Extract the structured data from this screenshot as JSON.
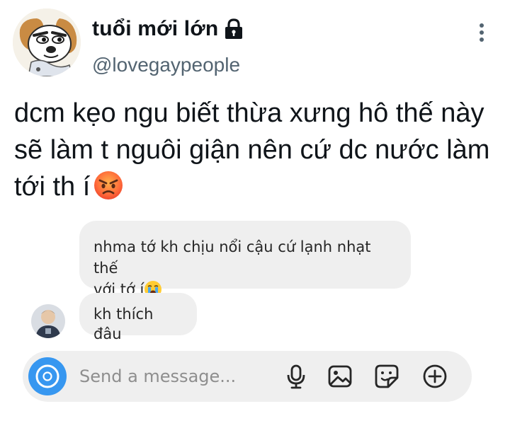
{
  "post": {
    "display_name": "tuổi mới lớn",
    "handle": "@lovegaypeople",
    "text": "dcm kẹo ngu biết thừa xưng hô thế này sẽ làm t nguôi giận nên cứ dc nước làm tới th í",
    "text_emoji": "angry-face-emoji"
  },
  "chat": {
    "messages": [
      {
        "text_line1": "nhma tớ kh chịu nổi cậu cứ lạnh nhạt thế",
        "text_line2": "với tớ í",
        "emoji": "loudly-crying-face-emoji"
      },
      {
        "text": "kh thích đâu"
      }
    ],
    "composer": {
      "placeholder": "Send a message...",
      "icons": [
        "camera-icon",
        "microphone-icon",
        "image-icon",
        "sticker-icon",
        "plus-circle-icon"
      ]
    }
  },
  "colors": {
    "text_primary": "#0f1419",
    "text_secondary": "#536471",
    "bubble_bg": "#efefef",
    "camera_blue": "#3797f0"
  }
}
